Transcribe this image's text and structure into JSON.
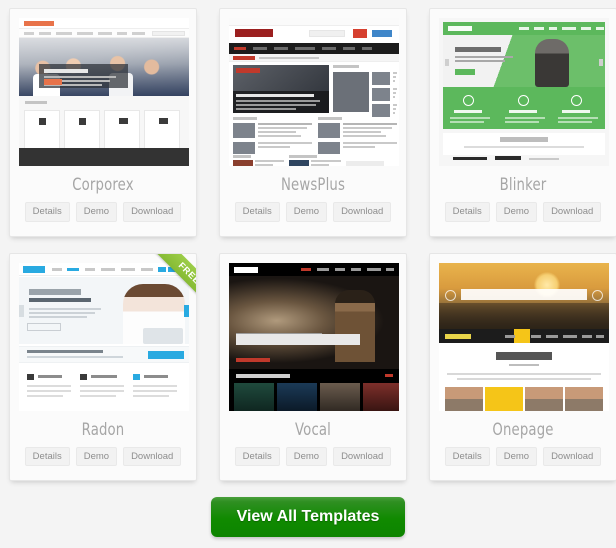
{
  "page": {
    "background": "#f4f4f4",
    "accent_green": "#0d8400",
    "ribbon_green": "#8cc63e"
  },
  "cards": [
    {
      "id": "corporex",
      "title": "Corporex",
      "free": false,
      "preview_alt": "Corporex corporate Joomla template preview",
      "buttons": [
        {
          "name": "details",
          "label": "Details"
        },
        {
          "name": "demo",
          "label": "Demo"
        },
        {
          "name": "download",
          "label": "Download"
        }
      ]
    },
    {
      "id": "newsplus",
      "title": "NewsPlus",
      "free": false,
      "preview_alt": "NewsPlus magazine news template preview",
      "buttons": [
        {
          "name": "details",
          "label": "Details"
        },
        {
          "name": "demo",
          "label": "Demo"
        },
        {
          "name": "download",
          "label": "Download"
        }
      ]
    },
    {
      "id": "blinker",
      "title": "Blinker",
      "free": false,
      "preview_alt": "Blinker green business template preview",
      "buttons": [
        {
          "name": "details",
          "label": "Details"
        },
        {
          "name": "demo",
          "label": "Demo"
        },
        {
          "name": "download",
          "label": "Download"
        }
      ]
    },
    {
      "id": "radon",
      "title": "Radon",
      "free": true,
      "free_label": "FREE",
      "preview_alt": "Radon professional clean Joomla template preview",
      "buttons": [
        {
          "name": "details",
          "label": "Details"
        },
        {
          "name": "demo",
          "label": "Demo"
        },
        {
          "name": "download",
          "label": "Download"
        }
      ]
    },
    {
      "id": "vocal",
      "title": "Vocal",
      "free": false,
      "preview_alt": "Vocal music festival dark template preview",
      "buttons": [
        {
          "name": "details",
          "label": "Details"
        },
        {
          "name": "demo",
          "label": "Demo"
        },
        {
          "name": "download",
          "label": "Download"
        }
      ]
    },
    {
      "id": "onepage",
      "title": "Onepage",
      "free": false,
      "preview_alt": "Onepage template preview with About Us section",
      "buttons": [
        {
          "name": "details",
          "label": "Details"
        },
        {
          "name": "demo",
          "label": "Demo"
        },
        {
          "name": "download",
          "label": "Download"
        }
      ]
    }
  ],
  "footer": {
    "view_all_label": "View All Templates"
  }
}
